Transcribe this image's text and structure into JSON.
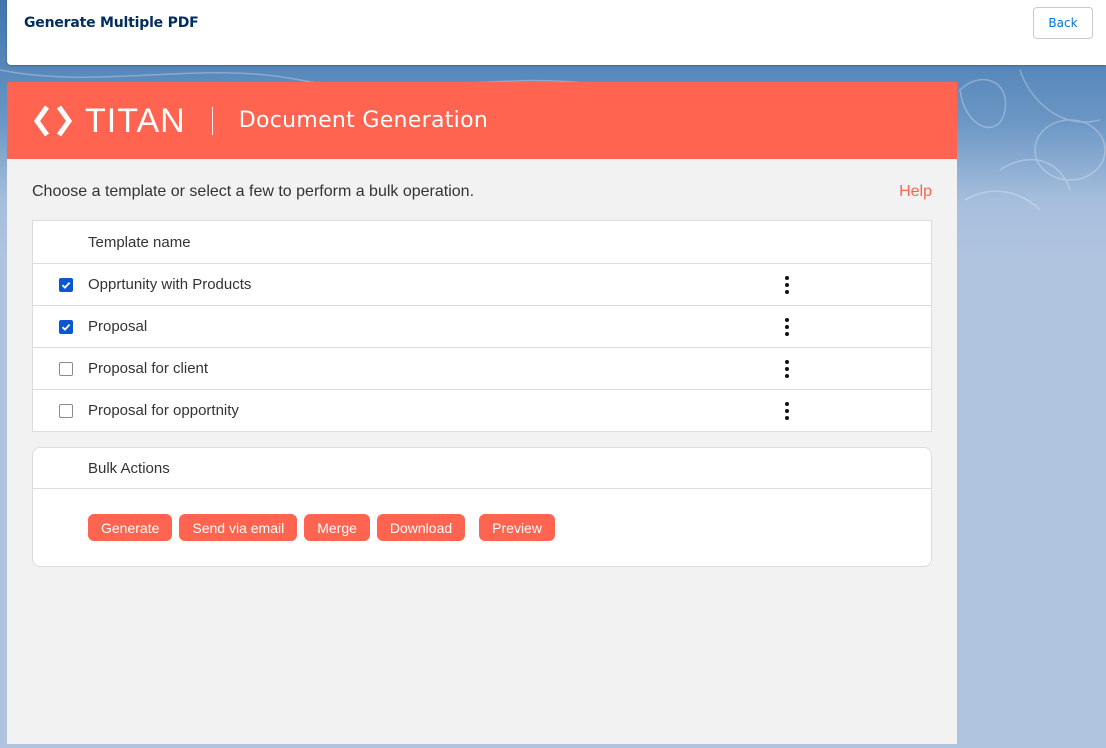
{
  "header": {
    "title": "Generate Multiple PDF",
    "back_label": "Back"
  },
  "brand": {
    "logo_text": "TITAN",
    "subtitle": "Document Generation",
    "color": "#ff6450"
  },
  "intro": {
    "text": "Choose a template or select a few to perform a bulk operation.",
    "help_label": "Help"
  },
  "templates": {
    "column_header": "Template name",
    "rows": [
      {
        "name": "Opprtunity with Products",
        "checked": true
      },
      {
        "name": "Proposal",
        "checked": true
      },
      {
        "name": "Proposal for client",
        "checked": false
      },
      {
        "name": "Proposal for opportnity",
        "checked": false
      }
    ]
  },
  "bulk_actions": {
    "title": "Bulk Actions",
    "buttons": [
      "Generate",
      "Send via email",
      "Merge",
      "Download",
      "Preview"
    ]
  },
  "colors": {
    "accent": "#ff6450",
    "checkbox_checked": "#0b57d0",
    "title_navy": "#032d60",
    "link_blue": "#0176d3"
  }
}
